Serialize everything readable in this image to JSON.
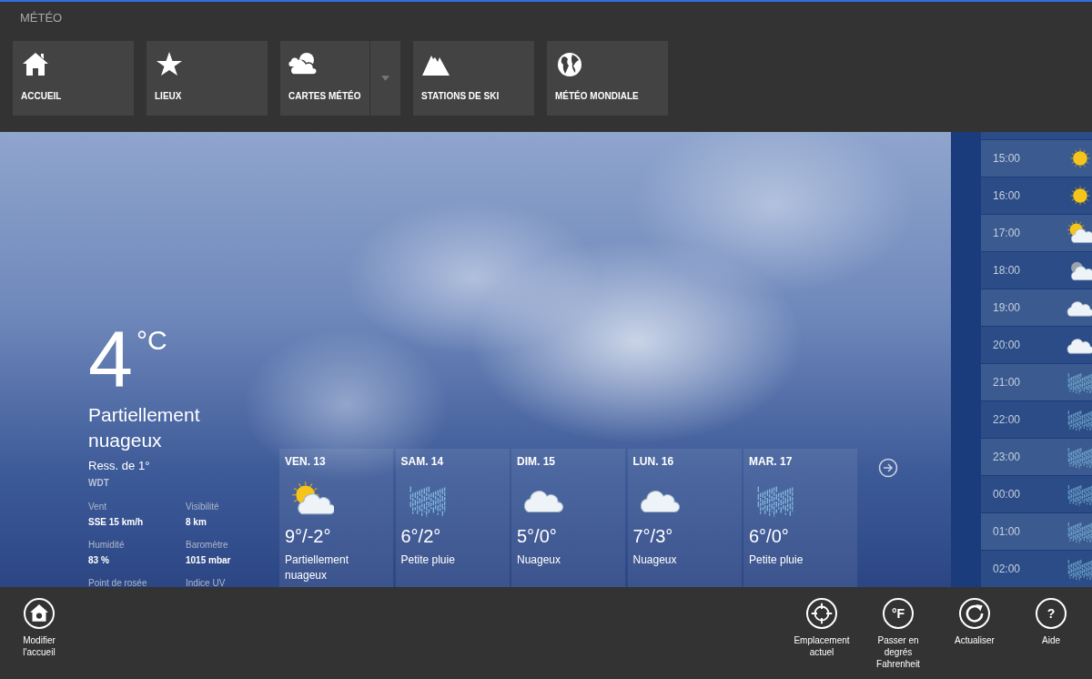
{
  "app_title": "MÉTÉO",
  "nav": [
    {
      "label": "ACCUEIL",
      "kind": "home",
      "has_menu": false
    },
    {
      "label": "LIEUX",
      "kind": "star",
      "has_menu": false
    },
    {
      "label": "CARTES MÉTÉO",
      "kind": "clouds",
      "has_menu": true
    },
    {
      "label": "STATIONS DE SKI",
      "kind": "mountain",
      "has_menu": false
    },
    {
      "label": "MÉTÉO MONDIALE",
      "kind": "globe",
      "has_menu": false
    }
  ],
  "current": {
    "temperature": "4",
    "unit": "°C",
    "condition": "Partiellement nuageux",
    "feels_like": "Ress. de 1°",
    "source": "WDT",
    "details": [
      {
        "label": "Vent",
        "value": "SSE 15 km/h"
      },
      {
        "label": "Visibilité",
        "value": "8 km"
      },
      {
        "label": "Humidité",
        "value": "83 %"
      },
      {
        "label": "Baromètre",
        "value": "1015 mbar"
      },
      {
        "label": "Point de rosée"
      },
      {
        "label": "Indice UV"
      }
    ]
  },
  "forecast": [
    {
      "day": "VEN. 13",
      "kind": "sun-cloud",
      "temps": "9°/-2°",
      "condition": "Partiellement nuageux"
    },
    {
      "day": "SAM. 14",
      "kind": "rain",
      "temps": "6°/2°",
      "condition": "Petite pluie"
    },
    {
      "day": "DIM. 15",
      "kind": "cloud",
      "temps": "5°/0°",
      "condition": "Nuageux"
    },
    {
      "day": "LUN. 16",
      "kind": "cloud",
      "temps": "7°/3°",
      "condition": "Nuageux"
    },
    {
      "day": "MAR. 17",
      "kind": "rain",
      "temps": "6°/0°",
      "condition": "Petite pluie"
    }
  ],
  "hourly": [
    {
      "time": "15:00",
      "kind": "sun"
    },
    {
      "time": "16:00",
      "kind": "sun"
    },
    {
      "time": "17:00",
      "kind": "sun-cloud"
    },
    {
      "time": "18:00",
      "kind": "moon-cloud"
    },
    {
      "time": "19:00",
      "kind": "cloud"
    },
    {
      "time": "20:00",
      "kind": "cloud"
    },
    {
      "time": "21:00",
      "kind": "rain"
    },
    {
      "time": "22:00",
      "kind": "rain"
    },
    {
      "time": "23:00",
      "kind": "rain"
    },
    {
      "time": "00:00",
      "kind": "rain"
    },
    {
      "time": "01:00",
      "kind": "rain"
    },
    {
      "time": "02:00",
      "kind": "rain"
    }
  ],
  "app_bar_left": [
    {
      "kind": "home-edit",
      "label": "Modifier l'accueil"
    }
  ],
  "app_bar_right": [
    {
      "kind": "target",
      "label": "Emplacement actuel"
    },
    {
      "kind": "glyph",
      "glyph": "°F",
      "label": "Passer en degrés Fahrenheit"
    },
    {
      "kind": "refresh",
      "label": "Actualiser"
    },
    {
      "kind": "glyph",
      "glyph": "?",
      "label": "Aide"
    }
  ]
}
